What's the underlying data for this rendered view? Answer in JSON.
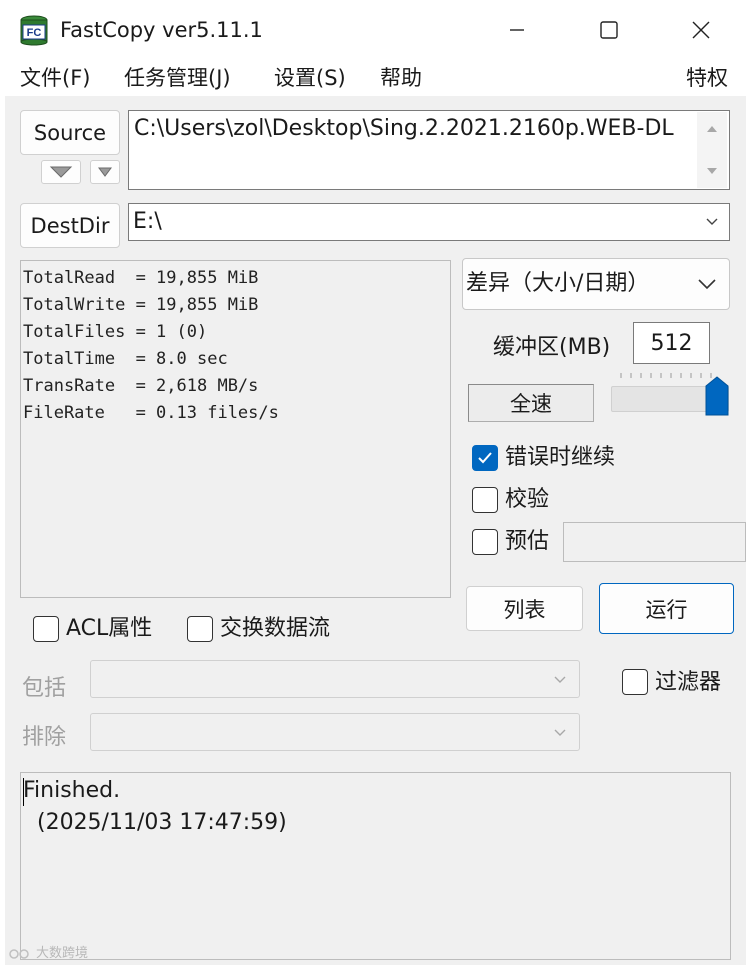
{
  "window": {
    "title": "FastCopy ver5.11.1",
    "icon_name": "fastcopy-app-icon",
    "icon_text": "FC",
    "controls": [
      "minimize-icon",
      "maximize-icon",
      "close-icon"
    ]
  },
  "menu": {
    "items": [
      "文件(F)",
      "任务管理(J)",
      "设置(S)",
      "帮助"
    ],
    "right_item": "特权"
  },
  "source": {
    "button_label": "Source",
    "path": "C:\\Users\\zol\\Desktop\\Sing.2.2021.2160p.WEB-DL"
  },
  "destdir": {
    "button_label": "DestDir",
    "path": "E:\\"
  },
  "stats": {
    "lines": [
      "TotalRead  = 19,855 MiB",
      "TotalWrite = 19,855 MiB",
      "TotalFiles = 1 (0)",
      "TotalTime  = 8.0 sec",
      "TransRate  = 2,618 MB/s",
      "FileRate   = 0.13 files/s"
    ]
  },
  "mode": {
    "selected": "差异（大小/日期）"
  },
  "buffer": {
    "label": "缓冲区(MB)",
    "value": "512"
  },
  "speed": {
    "button_label": "全速",
    "slider_level_percent": 100
  },
  "options": {
    "continue_on_error": {
      "label": "错误时继续",
      "checked": true
    },
    "verify": {
      "label": "校验",
      "checked": false
    },
    "estimate": {
      "label": "预估",
      "checked": false
    }
  },
  "actions": {
    "list_label": "列表",
    "run_label": "运行"
  },
  "extra": {
    "acl": {
      "label": "ACL属性",
      "checked": false
    },
    "ads": {
      "label": "交换数据流",
      "checked": false
    }
  },
  "filters": {
    "include_label": "包括",
    "exclude_label": "排除",
    "filter_checkbox": {
      "label": "过滤器",
      "checked": false
    }
  },
  "log": {
    "line1": "Finished.",
    "line2": "  (2025/11/03 17:47:59)"
  },
  "watermark": {
    "text": "大数跨境"
  },
  "colors": {
    "accent": "#0067c0",
    "client_bg": "#f0f0f0",
    "disabled_text": "#a0a0a0"
  }
}
